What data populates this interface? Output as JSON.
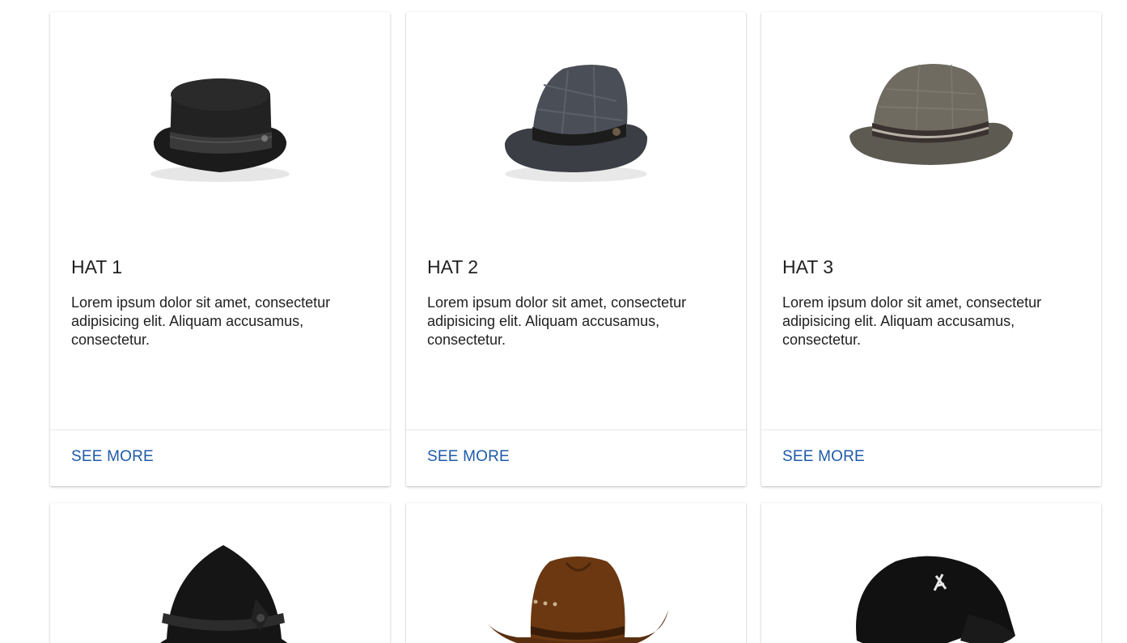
{
  "cards": [
    {
      "title": "HAT 1",
      "text": "Lorem ipsum dolor sit amet, consectetur adipisicing elit. Aliquam accusamus, consectetur.",
      "action_label": "SEE MORE",
      "image_icon": "top-hat-icon"
    },
    {
      "title": "HAT 2",
      "text": "Lorem ipsum dolor sit amet, consectetur adipisicing elit. Aliquam accusamus, consectetur.",
      "action_label": "SEE MORE",
      "image_icon": "plaid-fedora-icon"
    },
    {
      "title": "HAT 3",
      "text": "Lorem ipsum dolor sit amet, consectetur adipisicing elit. Aliquam accusamus, consectetur.",
      "action_label": "SEE MORE",
      "image_icon": "straw-fedora-icon"
    },
    {
      "image_icon": "cloche-hat-icon"
    },
    {
      "image_icon": "cowboy-hat-icon"
    },
    {
      "image_icon": "baseball-cap-icon"
    }
  ],
  "colors": {
    "link": "#1e5aa8",
    "text": "#212121",
    "divider": "#e8e8e8"
  }
}
